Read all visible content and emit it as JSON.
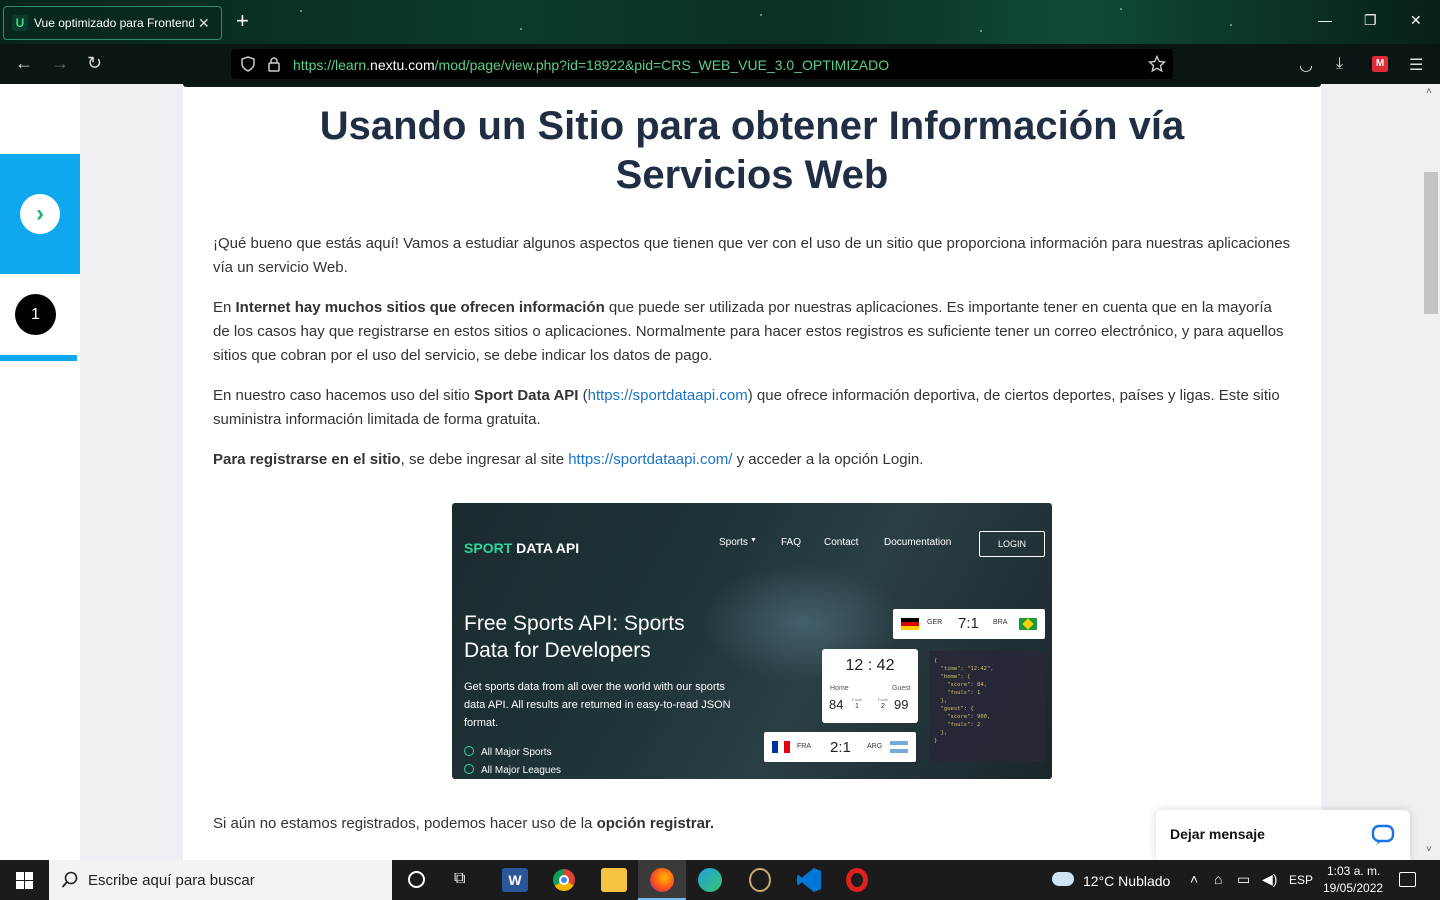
{
  "browser": {
    "tab_title": "Vue optimizado para Frontend",
    "tab_favicon": "U",
    "url_prefix": "https://learn.",
    "url_domain": "nextu.com",
    "url_path": "/mod/page/view.php?id=18922&pid=CRS_WEB_VUE_3.0_OPTIMIZADO"
  },
  "sidebar": {
    "step_number": "1"
  },
  "article": {
    "title": "Usando un Sitio para obtener Información vía Servicios Web",
    "p1": "¡Qué bueno que estás aquí! Vamos a estudiar algunos aspectos que tienen que ver con el uso de un sitio que proporciona información para nuestras aplicaciones vía un servicio Web.",
    "p2_a": "En ",
    "p2_bold": "Internet hay muchos sitios que ofrecen información",
    "p2_b": " que puede ser utilizada por nuestras aplicaciones. Es importante tener en cuenta que en la mayoría de los casos hay que registrarse en estos sitios o aplicaciones. Normalmente para hacer estos registros es suficiente tener un correo electrónico, y para aquellos sitios que cobran por el uso del servicio, se debe indicar los datos de pago.",
    "p3_a": "En nuestro caso hacemos uso del sitio ",
    "p3_bold": "Sport Data API",
    "p3_b": " (",
    "p3_link": "https://sportdataapi.com",
    "p3_c": ") que ofrece información deportiva, de ciertos deportes, países y ligas. Este sitio suministra información limitada de forma gratuita.",
    "p4_bold": "Para registrarse en el sitio",
    "p4_a": ", se debe ingresar al site ",
    "p4_link": "https://sportdataapi.com/",
    "p4_b": " y acceder a la opción Login.",
    "p5_a": "Si aún no estamos registrados, podemos hacer uso de la ",
    "p5_bold": "opción registrar."
  },
  "screenshot": {
    "logo_a": "SP",
    "logo_o": "O",
    "logo_b": "RT",
    "logo_c": " DATA API",
    "nav": [
      "Sports",
      "FAQ",
      "Contact",
      "Documentation"
    ],
    "login": "LOGIN",
    "headline": "Free Sports API: Sports Data for Developers",
    "sub": "Get sports data from all over the world with our sports data API. All results are returned in easy-to-read JSON format.",
    "check1": "All Major Sports",
    "check2": "All Major Leagues",
    "score1_home": "GER",
    "score1": "7:1",
    "score1_away": "BRA",
    "clock": "12 : 42",
    "home_label": "Home",
    "guest_label": "Guest",
    "home_score": "84",
    "guest_score": "99",
    "fouls_label": "Fouls",
    "home_fouls": "1",
    "guest_fouls": "2",
    "score2_home": "FRA",
    "score2": "2:1",
    "score2_away": "ARG",
    "json_code": "{\n  \"time\": \"12:42\",\n  \"home\": {\n    \"score\": 84,\n    \"fouls\": 1\n  },\n  \"guest\": {\n    \"score\": 900,\n    \"fouls\": 2\n  },\n}"
  },
  "chat": {
    "label": "Dejar mensaje"
  },
  "taskbar": {
    "search_placeholder": "Escribe aquí para buscar",
    "weather": "12°C  Nublado",
    "lang": "ESP",
    "time": "1:03 a. m.",
    "date": "19/05/2022"
  }
}
